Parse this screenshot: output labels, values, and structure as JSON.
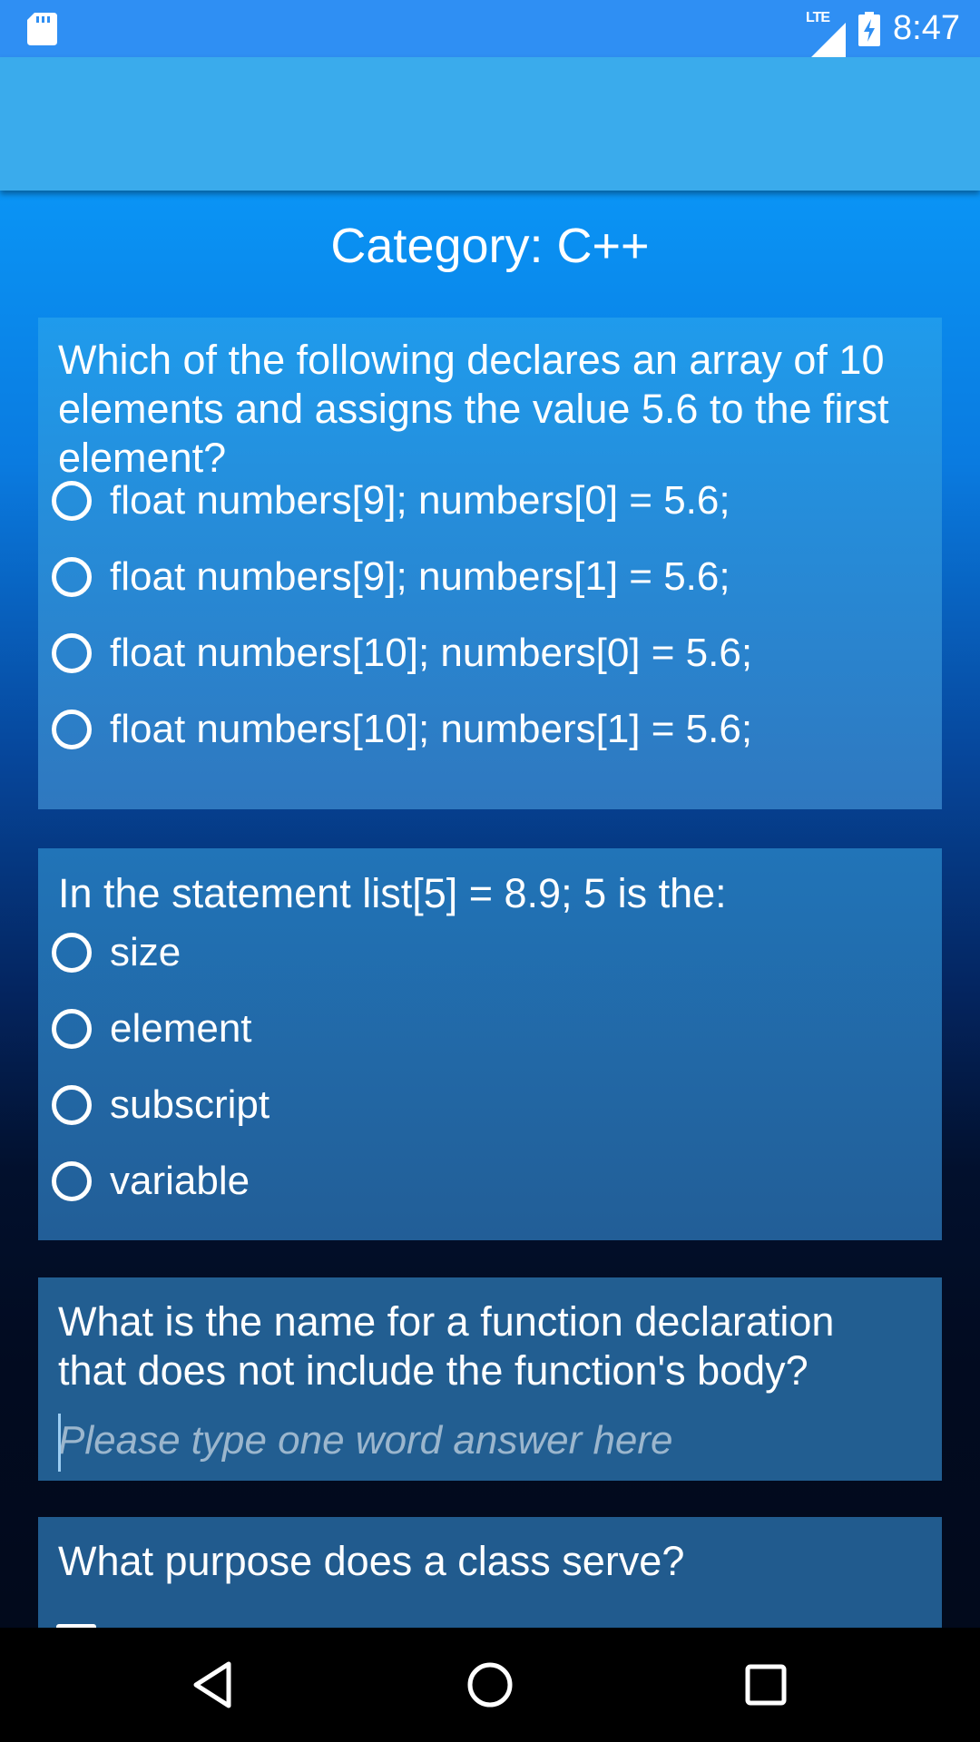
{
  "status_bar": {
    "network": "LTE",
    "time": "8:47",
    "icons": [
      "sd-card-icon",
      "signal-icon",
      "battery-charging-icon"
    ]
  },
  "page": {
    "category_title": "Category: C++"
  },
  "questions": [
    {
      "text": "Which of the following declares an array of 10 elements and assigns the value 5.6 to the first element?",
      "type": "radio",
      "options": [
        "float numbers[9]; numbers[0] = 5.6;",
        "float numbers[9]; numbers[1] = 5.6;",
        "float numbers[10]; numbers[0] = 5.6;",
        "float numbers[10]; numbers[1] = 5.6;"
      ]
    },
    {
      "text": "In the statement list[5] = 8.9; 5 is the:",
      "type": "radio",
      "options": [
        "size",
        "element",
        "subscript",
        "variable"
      ]
    },
    {
      "text": "What is the name for a function declaration that does not include the function's body?",
      "type": "text",
      "value": "",
      "placeholder": "Please type one word answer here"
    },
    {
      "text": "What purpose does a class serve?",
      "type": "checkbox"
    }
  ],
  "nav_bar": {
    "icons": [
      "back-icon",
      "home-icon",
      "recent-apps-icon"
    ]
  }
}
